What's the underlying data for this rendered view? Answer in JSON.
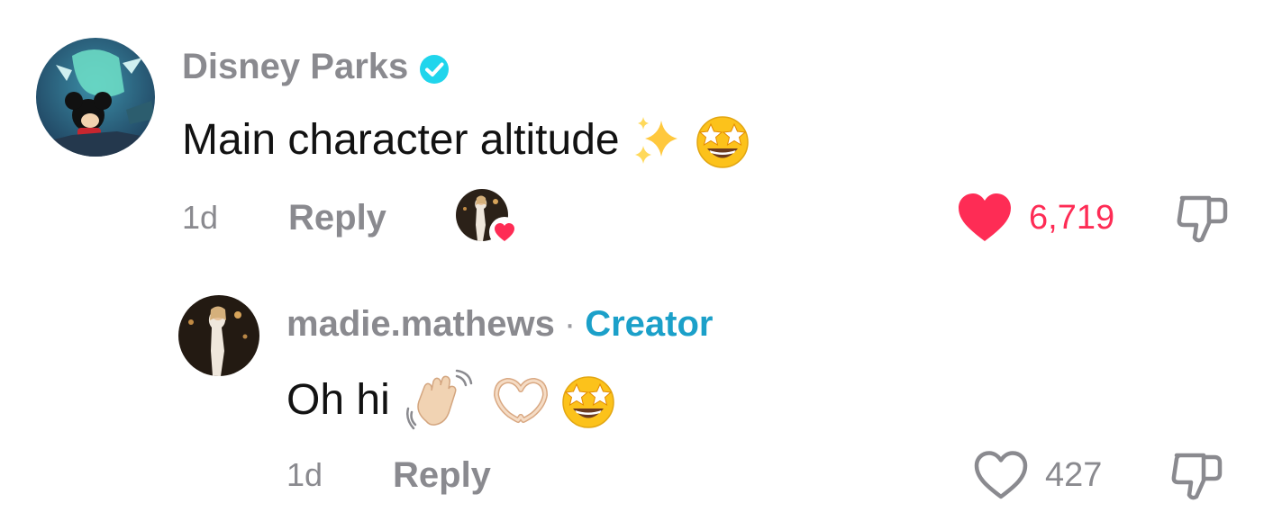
{
  "comments": [
    {
      "username": "Disney Parks",
      "verified": true,
      "avatar_icon": "mickey-avatar",
      "text": "Main character altitude",
      "emojis": [
        "sparkles-emoji",
        "star-struck-emoji"
      ],
      "time": "1d",
      "reply_label": "Reply",
      "creator_liked": true,
      "liked": true,
      "like_count": "6,719",
      "like_color": "#fe2c55"
    },
    {
      "username": "madie.mathews",
      "separator": "·",
      "tag": "Creator",
      "tag_color": "#1ba0c9",
      "avatar_icon": "creator-avatar",
      "text": "Oh hi",
      "emojis": [
        "waving-hand-emoji",
        "heart-hands-emoji",
        "star-struck-emoji"
      ],
      "time": "1d",
      "reply_label": "Reply",
      "liked": false,
      "like_count": "427"
    }
  ]
}
